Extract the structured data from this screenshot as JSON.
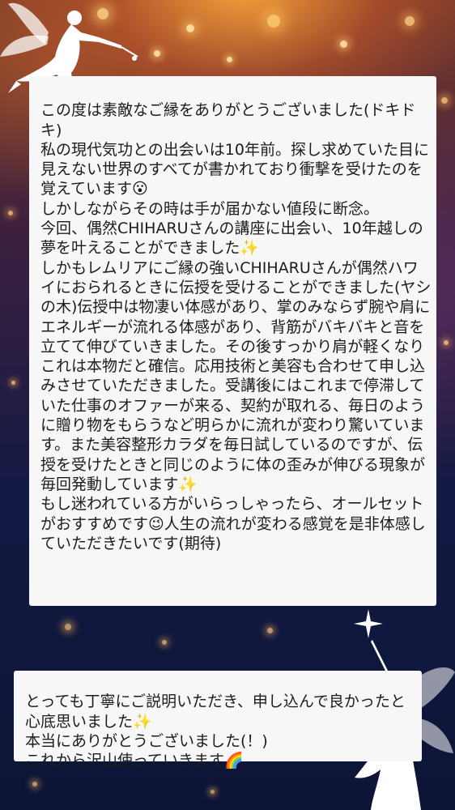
{
  "testimonial": {
    "main_text": "この度は素敵なご縁をありがとうございました(ドキドキ)\n私の現代気功との出会いは10年前。探し求めていた目に見えない世界のすべてが書かれており衝撃を受けたのを覚えています😮\nしかしながらその時は手が届かない値段に断念。\n今回、偶然CHIHARUさんの講座に出会い、10年越しの夢を叶えることができました✨\nしかもレムリアにご縁の強いCHIHARUさんが偶然ハワイにおられるときに伝授を受けることができました(ヤシの木)伝授中は物凄い体感があり、掌のみならず腕や肩にエネルギーが流れる体感があり、背筋がバキバキと音を立てて伸びていきました。その後すっかり肩が軽くなりこれは本物だと確信。応用技術と美容も合わせて申し込みさせていただきました。受講後にはこれまで停滞していた仕事のオファーが来る、契約が取れる、毎日のように贈り物をもらうなど明らかに流れが変わり驚いています。また美容整形カラダを毎日試しているのですが、伝授を受けたときと同じのように体の歪みが伸びる現象が毎回発動しています✨\nもし迷われている方がいらっしゃったら、オールセットがおすすめです😉人生の流れが変わる感覚を是非体感していただきたいです(期待)",
    "second_text": "とっても丁寧にご説明いただき、申し込んで良かったと心底思いました✨\n本当にありがとうございました(！)\nこれから沢山使っていきます🌈"
  },
  "decor": {
    "fairy_top": "fairy-silhouette-top-left",
    "fairy_bottom": "fairy-silhouette-bottom-right",
    "sparkle": "sparkle-star",
    "fairy_color": "#ffffff"
  }
}
